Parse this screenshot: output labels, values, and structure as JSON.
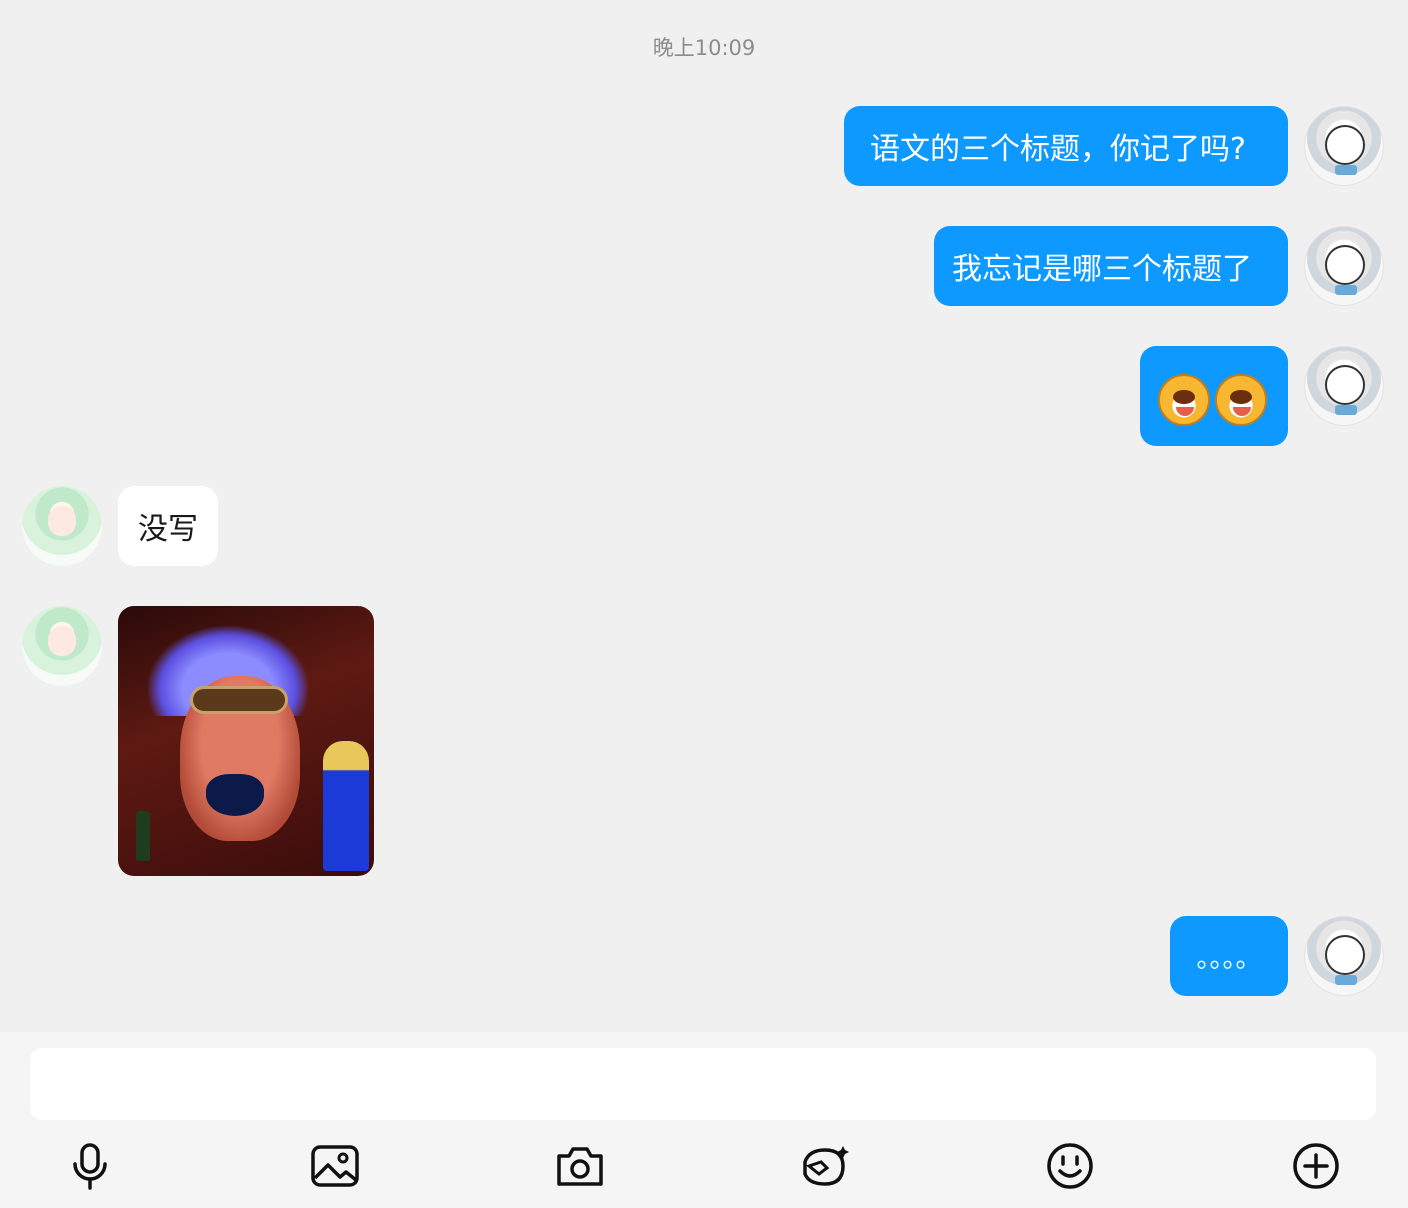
{
  "timestamp": "晚上10:09",
  "messages": [
    {
      "text": "语文的三个标题，你记了吗?"
    },
    {
      "text": "我忘记是哪三个标题了"
    },
    {
      "text": "没写"
    },
    {
      "text": "。。。。"
    }
  ],
  "icons": {
    "emoji_sticker": "dog-face-emoji",
    "toolbar": [
      "microphone-icon",
      "image-icon",
      "camera-icon",
      "sticker-icon",
      "smiley-icon",
      "plus-circle-icon"
    ]
  },
  "input": {
    "value": "",
    "placeholder": ""
  },
  "colors": {
    "outgoing_bubble": "#0d99ff",
    "incoming_bubble": "#ffffff",
    "background": "#f0f0f0"
  }
}
